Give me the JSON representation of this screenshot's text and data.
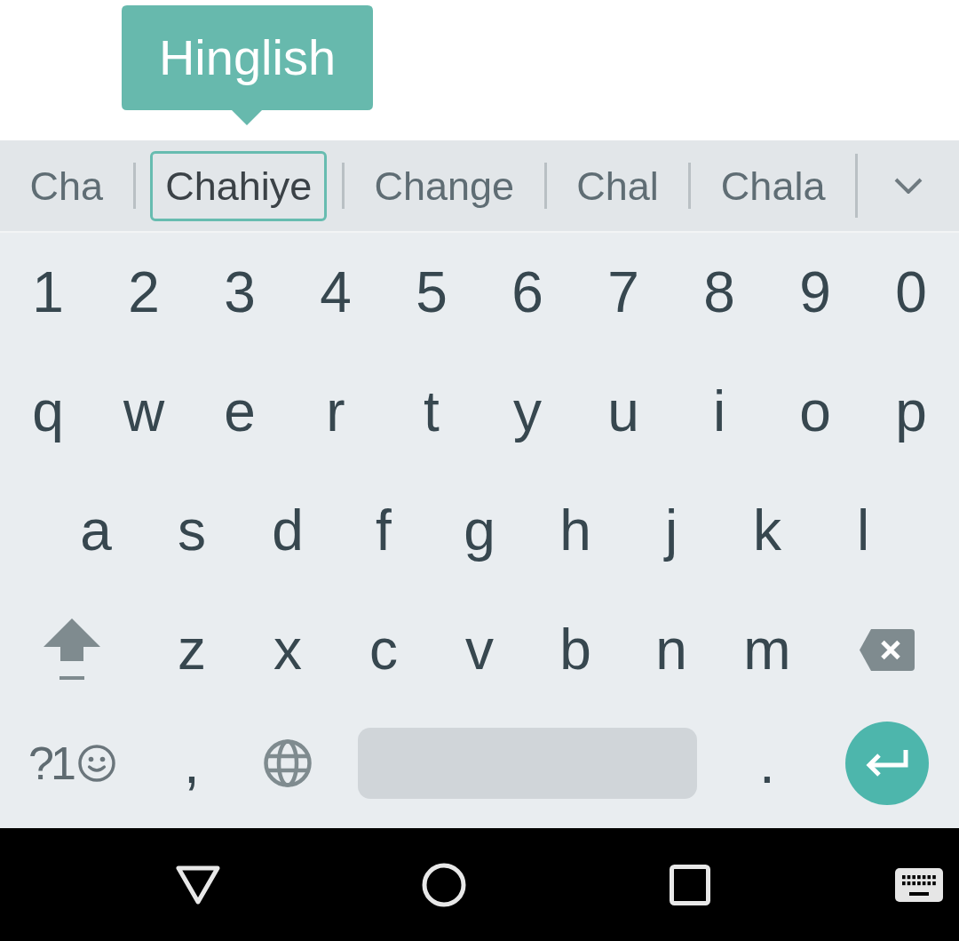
{
  "language_tooltip": {
    "label": "Hinglish"
  },
  "suggestions": [
    {
      "text": "Cha",
      "selected": false
    },
    {
      "text": "Chahiye",
      "selected": true
    },
    {
      "text": "Change",
      "selected": false
    },
    {
      "text": "Chal",
      "selected": false
    },
    {
      "text": "Chala",
      "selected": false
    }
  ],
  "keyboard": {
    "rows": [
      {
        "keys": [
          {
            "kind": "char",
            "label": "1"
          },
          {
            "kind": "char",
            "label": "2"
          },
          {
            "kind": "char",
            "label": "3"
          },
          {
            "kind": "char",
            "label": "4"
          },
          {
            "kind": "char",
            "label": "5"
          },
          {
            "kind": "char",
            "label": "6"
          },
          {
            "kind": "char",
            "label": "7"
          },
          {
            "kind": "char",
            "label": "8"
          },
          {
            "kind": "char",
            "label": "9"
          },
          {
            "kind": "char",
            "label": "0"
          }
        ]
      },
      {
        "keys": [
          {
            "kind": "char",
            "label": "q"
          },
          {
            "kind": "char",
            "label": "w"
          },
          {
            "kind": "char",
            "label": "e"
          },
          {
            "kind": "char",
            "label": "r"
          },
          {
            "kind": "char",
            "label": "t"
          },
          {
            "kind": "char",
            "label": "y"
          },
          {
            "kind": "char",
            "label": "u"
          },
          {
            "kind": "char",
            "label": "i"
          },
          {
            "kind": "char",
            "label": "o"
          },
          {
            "kind": "char",
            "label": "p"
          }
        ]
      },
      {
        "keys": [
          {
            "kind": "char",
            "label": "a"
          },
          {
            "kind": "char",
            "label": "s"
          },
          {
            "kind": "char",
            "label": "d"
          },
          {
            "kind": "char",
            "label": "f"
          },
          {
            "kind": "char",
            "label": "g"
          },
          {
            "kind": "char",
            "label": "h"
          },
          {
            "kind": "char",
            "label": "j"
          },
          {
            "kind": "char",
            "label": "k"
          },
          {
            "kind": "char",
            "label": "l"
          }
        ]
      },
      {
        "keys": [
          {
            "kind": "shift"
          },
          {
            "kind": "char",
            "label": "z"
          },
          {
            "kind": "char",
            "label": "x"
          },
          {
            "kind": "char",
            "label": "c"
          },
          {
            "kind": "char",
            "label": "v"
          },
          {
            "kind": "char",
            "label": "b"
          },
          {
            "kind": "char",
            "label": "n"
          },
          {
            "kind": "char",
            "label": "m"
          },
          {
            "kind": "backspace"
          }
        ]
      },
      {
        "keys": [
          {
            "kind": "symbols",
            "label": "?1"
          },
          {
            "kind": "char",
            "label": ","
          },
          {
            "kind": "globe"
          },
          {
            "kind": "space"
          },
          {
            "kind": "char",
            "label": "."
          },
          {
            "kind": "enter"
          }
        ]
      }
    ]
  }
}
